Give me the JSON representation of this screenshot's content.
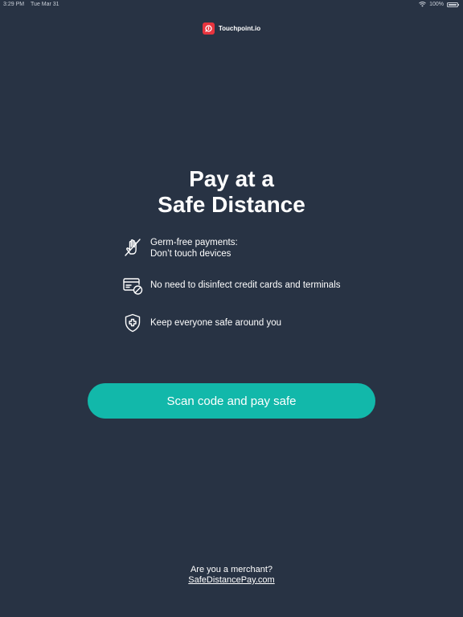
{
  "status_bar": {
    "time": "3:29 PM",
    "date": "Tue Mar 31",
    "battery": "100%",
    "icons": [
      "wifi-icon",
      "battery-icon"
    ]
  },
  "brand": {
    "name": "Touchpoint.io",
    "logo_color": "#e8343e"
  },
  "headline": {
    "line1": "Pay at a",
    "line2": "Safe Distance"
  },
  "features": [
    {
      "icon": "no-touch-hand-icon",
      "line1": "Germ-free payments:",
      "line2": "Don’t touch devices"
    },
    {
      "icon": "card-blocked-icon",
      "text": "No need to disinfect credit cards and terminals"
    },
    {
      "icon": "shield-cross-icon",
      "text": "Keep everyone safe around you"
    }
  ],
  "cta": {
    "label": "Scan code and pay safe",
    "color": "#12b8aa"
  },
  "footer": {
    "question": "Are you a merchant?",
    "link": "SafeDistancePay.com"
  },
  "colors": {
    "background": "#283344",
    "text": "#ffffff"
  }
}
